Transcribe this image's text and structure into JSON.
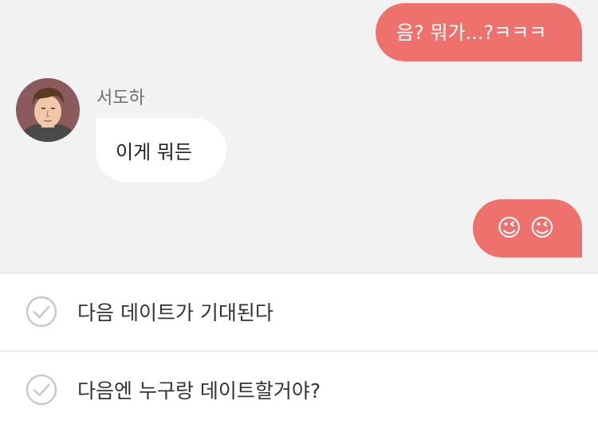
{
  "chat": {
    "messages": [
      {
        "direction": "outgoing",
        "text": "음? 뭐가...?ㅋㅋㅋ"
      },
      {
        "direction": "incoming",
        "sender": "서도하",
        "text": "이게 뭐든"
      },
      {
        "direction": "outgoing",
        "text": "😉😉"
      }
    ]
  },
  "choices": [
    {
      "label": "다음 데이트가 기대된다",
      "icon": "check-circle-icon"
    },
    {
      "label": "다음엔 누구랑 데이트할거야?",
      "icon": "check-circle-icon"
    }
  ],
  "colors": {
    "outgoing_bubble": "#ef716d",
    "incoming_bubble": "#ffffff",
    "chat_background": "#f2f2f2",
    "divider": "#d9d9d9",
    "check_icon": "#c8c8c8"
  }
}
